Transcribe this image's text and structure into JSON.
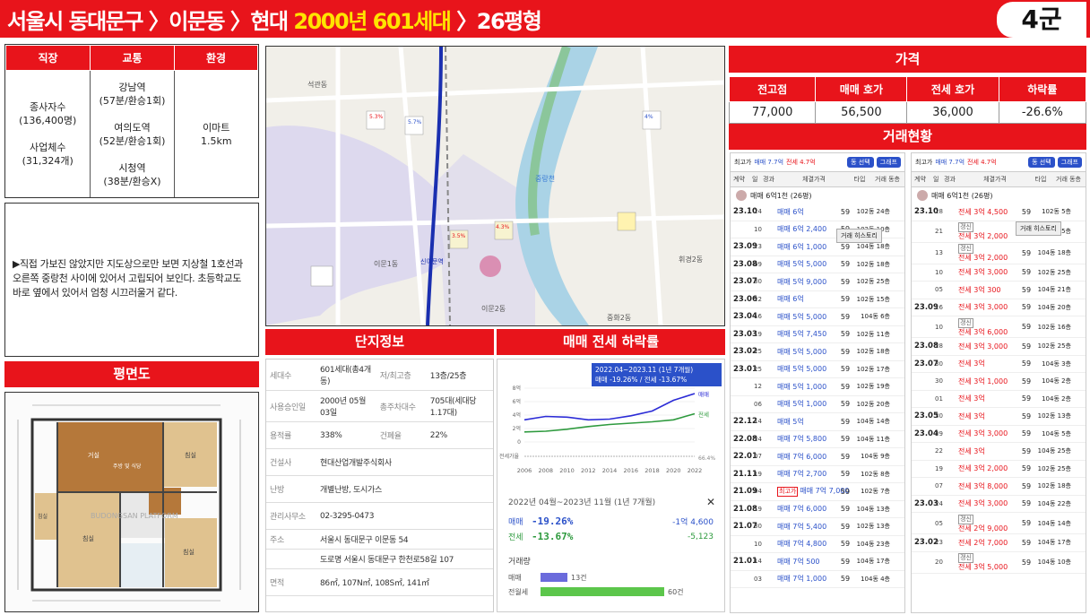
{
  "header": {
    "title_pre": "서울시 동대문구 〉이문동 〉현대 ",
    "title_hl": "2000년 601세대",
    "title_post": " 〉26평형",
    "group": "4군"
  },
  "env": {
    "headers": [
      "직장",
      "교통",
      "환경"
    ],
    "work": [
      "종사자수",
      "(136,400명)",
      "사업체수",
      "(31,324개)"
    ],
    "transit": [
      "강남역",
      "(57분/환승1회)",
      "여의도역",
      "(52분/환승1회)",
      "시청역",
      "(38분/환승X)"
    ],
    "nature": [
      "이마트",
      "1.5km"
    ]
  },
  "note": "▶직접 가보진 않았지만 지도상으로만 보면 지상철 1호선과 오른쪽 중랑천 사이에 있어서 고립되어 보인다. 초등학교도 바로 옆에서 있어서 엄청 시끄러울거 같다.",
  "floorplan": {
    "label": "평면도",
    "watermark": "BUDONGSAN PLATFORM",
    "rooms": [
      "거실",
      "주방 및 식당",
      "침실",
      "침실",
      "침실",
      "침실"
    ]
  },
  "map": {
    "labels": [
      "석관동",
      "이문1동",
      "이문2동",
      "휘경2동",
      "중화2동",
      "중랑천",
      "신이문역"
    ],
    "markers": [
      "5.3%",
      "5.7%",
      "4%",
      "4.3%",
      "3.5%"
    ]
  },
  "complex": {
    "header": "단지정보",
    "rows": [
      [
        "세대수",
        "601세대(총4개동)",
        "저/최고층",
        "13층/25층"
      ],
      [
        "사용승인일",
        "2000년 05월 03일",
        "총주차대수",
        "705대(세대당 1.17대)"
      ],
      [
        "용적률",
        "338%",
        "건폐율",
        "22%"
      ],
      [
        "건설사",
        "현대산업개발주식회사",
        "",
        ""
      ],
      [
        "난방",
        "개별난방, 도시가스",
        "",
        ""
      ],
      [
        "관리사무소",
        "02-3295-0473",
        "",
        ""
      ],
      [
        "주소",
        "서울시 동대문구 이문동 54",
        "",
        ""
      ],
      [
        "주소2",
        "도로명 서울시 동대문구 한천로58길 107",
        "",
        ""
      ],
      [
        "면적",
        "86㎡, 107N㎡, 108S㎡, 141㎡",
        "",
        ""
      ]
    ]
  },
  "decline": {
    "header": "매매 전세 하락률",
    "banner1": "2022.04~2023.11 (1년 7개월)",
    "banner2": "매매 -19.26% / 전세 -13.67%",
    "period": "2022년 04월~2023년 11월 (1년 7개월)",
    "buy_label": "매매",
    "buy_pct": "-19.26%",
    "buy_amt": "-1억 4,600",
    "rent_label": "전세",
    "rent_pct": "-13.67%",
    "rent_amt": "-5,123",
    "vol_label": "거래량",
    "vol": [
      {
        "name": "매매",
        "count": "13건",
        "frac": 0.2
      },
      {
        "name": "전월세",
        "count": "60건",
        "frac": 0.92
      }
    ],
    "close": "✕"
  },
  "chart_data": {
    "type": "line",
    "x": [
      "2006",
      "2008",
      "2010",
      "2012",
      "2014",
      "2016",
      "2018",
      "2020",
      "2022"
    ],
    "yticks": [
      "8억",
      "6억",
      "4억",
      "2억",
      "0"
    ],
    "series": [
      {
        "name": "매매",
        "values": [
          3.3,
          3.8,
          3.7,
          3.3,
          3.4,
          3.9,
          4.6,
          6.2,
          7.2
        ]
      },
      {
        "name": "전세",
        "values": [
          1.5,
          1.6,
          1.9,
          2.3,
          2.6,
          2.8,
          3.0,
          3.3,
          4.2
        ]
      }
    ],
    "ylim": [
      0,
      8
    ],
    "lower_label": "전세가율",
    "pct_label": "66.4%"
  },
  "price": {
    "header": "가격",
    "cols": [
      "전고점",
      "매매 호가",
      "전세 호가",
      "하락률"
    ],
    "vals": [
      "77,000",
      "56,500",
      "36,000",
      "-26.6%"
    ]
  },
  "trade": {
    "header": "거래현황",
    "left": {
      "top": [
        "최고가",
        "매매 7.7억",
        "전세 4.7억",
        "동 선택",
        "그래프"
      ],
      "cols": [
        "계약",
        "일",
        "경과",
        "체결가격",
        "타입",
        "거래 동층"
      ],
      "sub": "매매 6억1천 (26평)",
      "tip": "거래 히스토리",
      "rows": [
        [
          "23.10",
          "24",
          "매매 6억",
          "59",
          "102동 24층",
          "b"
        ],
        [
          "",
          "10",
          "매매 6억 2,400",
          "59",
          "102동 10층",
          "b"
        ],
        [
          "23.09",
          "23",
          "매매 6억 1,000",
          "59",
          "104동 18층",
          "b"
        ],
        [
          "23.08",
          "09",
          "매매 5억 5,000",
          "59",
          "102동 18층",
          "b"
        ],
        [
          "23.07",
          "30",
          "매매 5억 9,000",
          "59",
          "102동 25층",
          "b"
        ],
        [
          "23.06",
          "22",
          "매매 6억",
          "59",
          "102동 15층",
          "b"
        ],
        [
          "23.04",
          "16",
          "매매 5억 5,000",
          "59",
          "104동 6층",
          "b"
        ],
        [
          "23.03",
          "19",
          "매매 5억 7,450",
          "59",
          "102동 11층",
          "b"
        ],
        [
          "23.02",
          "25",
          "매매 5억 5,000",
          "59",
          "102동 18층",
          "b"
        ],
        [
          "23.01",
          "25",
          "매매 5억 5,000",
          "59",
          "102동 17층",
          "b"
        ],
        [
          "",
          "12",
          "매매 5억 1,000",
          "59",
          "102동 19층",
          "b"
        ],
        [
          "",
          "06",
          "매매 5억 1,000",
          "59",
          "102동 20층",
          "b"
        ],
        [
          "22.12",
          "14",
          "매매 5억",
          "59",
          "104동 14층",
          "b"
        ],
        [
          "22.08",
          "24",
          "매매 7억 5,800",
          "59",
          "104동 11층",
          "b"
        ],
        [
          "22.01",
          "07",
          "매매 7억 6,000",
          "59",
          "104동 9층",
          "b"
        ],
        [
          "21.11",
          "19",
          "매매 7억 2,700",
          "59",
          "102동 8층",
          "b"
        ],
        [
          "21.09",
          "04",
          "매매 7억 7,000",
          "59",
          "102동 7층",
          "b"
        ],
        [
          "21.08",
          "19",
          "매매 7억 6,000",
          "59",
          "104동 13층",
          "b"
        ],
        [
          "21.07",
          "30",
          "매매 7억 5,400",
          "59",
          "102동 13층",
          "b"
        ],
        [
          "",
          "10",
          "매매 7억 4,800",
          "59",
          "104동 23층",
          "b"
        ],
        [
          "21.01",
          "14",
          "매매 7억 500",
          "59",
          "104동 17층",
          "b"
        ],
        [
          "",
          "03",
          "매매 7억 1,000",
          "59",
          "104동 4층",
          "b"
        ]
      ],
      "tag": "최고가"
    },
    "right": {
      "top": [
        "최고가",
        "매매 7.7억",
        "전세 4.7억",
        "동 선택",
        "그래프"
      ],
      "cols": [
        "계약",
        "일",
        "경과",
        "체결가격",
        "타입",
        "거래 동층"
      ],
      "sub": "매매 6억1천 (26평)",
      "tip": "거래 히스토리",
      "renew": "갱신",
      "rows": [
        [
          "23.10",
          "28",
          "전세 3억 4,500",
          "59",
          "102동 5층",
          ""
        ],
        [
          "",
          "21",
          "전세 3억 2,000",
          "59",
          "102동 5층",
          "갱신"
        ],
        [
          "",
          "13",
          "전세 3억 2,000",
          "59",
          "104동 18층",
          "갱신"
        ],
        [
          "",
          "10",
          "전세 3억 3,000",
          "59",
          "102동 25층",
          ""
        ],
        [
          "",
          "05",
          "전세 3억 300",
          "59",
          "104동 21층",
          ""
        ],
        [
          "23.09",
          "16",
          "전세 3억 3,000",
          "59",
          "104동 20층",
          ""
        ],
        [
          "",
          "10",
          "전세 3억 6,000",
          "59",
          "102동 16층",
          "갱신"
        ],
        [
          "23.08",
          "28",
          "전세 3억 3,000",
          "59",
          "102동 25층",
          ""
        ],
        [
          "23.07",
          "30",
          "전세 3억",
          "59",
          "104동 3층",
          ""
        ],
        [
          "",
          "30",
          "전세 3억 1,000",
          "59",
          "104동 2층",
          ""
        ],
        [
          "",
          "01",
          "전세 3억",
          "59",
          "104동 2층",
          ""
        ],
        [
          "23.05",
          "30",
          "전세 3억",
          "59",
          "102동 13층",
          ""
        ],
        [
          "23.04",
          "29",
          "전세 3억 3,000",
          "59",
          "104동 5층",
          ""
        ],
        [
          "",
          "22",
          "전세 3억",
          "59",
          "104동 25층",
          ""
        ],
        [
          "",
          "19",
          "전세 3억 2,000",
          "59",
          "102동 25층",
          ""
        ],
        [
          "",
          "07",
          "전세 3억 8,000",
          "59",
          "102동 18층",
          ""
        ],
        [
          "23.03",
          "24",
          "전세 3억 3,000",
          "59",
          "104동 22층",
          ""
        ],
        [
          "",
          "05",
          "전세 2억 9,000",
          "59",
          "104동 14층",
          "갱신"
        ],
        [
          "23.02",
          "23",
          "전세 2억 7,000",
          "59",
          "104동 17층",
          ""
        ],
        [
          "",
          "20",
          "전세 3억 5,000",
          "59",
          "104동 10층",
          "갱신"
        ]
      ]
    }
  }
}
